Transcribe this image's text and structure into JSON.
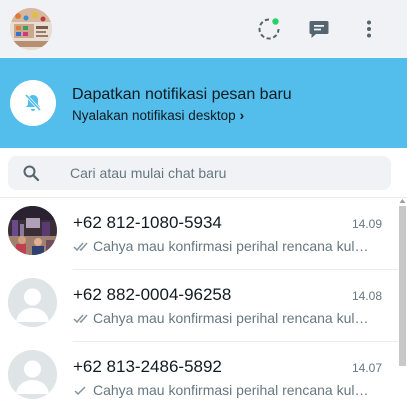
{
  "header": {
    "status_badge_color": "#25d366",
    "icons": [
      "status-icon",
      "new-chat-icon",
      "menu-icon"
    ]
  },
  "banner": {
    "title": "Dapatkan notifikasi pesan baru",
    "link": "Nyalakan notifikasi desktop",
    "link_chevron": "›",
    "bg_color": "#53bdeb",
    "icon": "bell-off-icon"
  },
  "search": {
    "placeholder": "Cari atau mulai chat baru",
    "value": ""
  },
  "chats": [
    {
      "name": "+62 812-1080-5934",
      "time": "14.09",
      "preview": "Cahya mau konfirmasi perihal rencana kuliah...",
      "tick": "double",
      "avatar": "photo"
    },
    {
      "name": "+62 882-0004-96258",
      "time": "14.08",
      "preview": "Cahya mau konfirmasi perihal rencana kuliah...",
      "tick": "double",
      "avatar": "default"
    },
    {
      "name": "+62 813-2486-5892",
      "time": "14.07",
      "preview": "Cahya mau konfirmasi perihal rencana kuliah ...",
      "tick": "single",
      "avatar": "default"
    }
  ]
}
